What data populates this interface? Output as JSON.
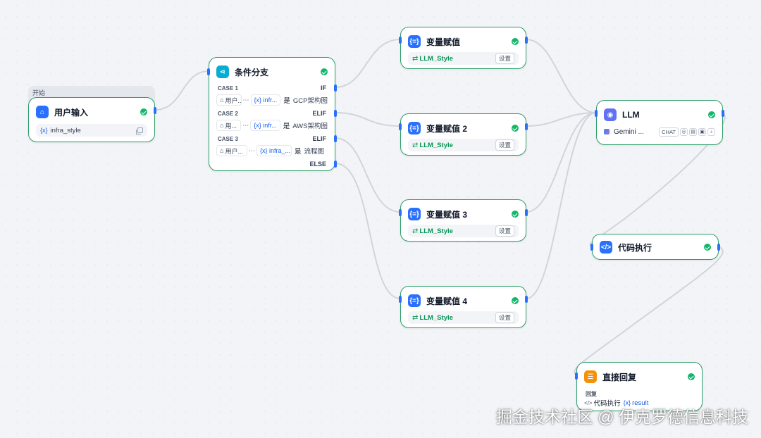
{
  "canvas": {
    "start_label": "开始",
    "watermark": "掘金技术社区 @ 伊克罗德信息科技"
  },
  "nodes": {
    "user_input": {
      "title": "用户输入",
      "icon": "home-icon",
      "variable": "infra_style"
    },
    "condition": {
      "title": "条件分支",
      "icon": "branch-icon",
      "cases": [
        {
          "label": "CASE 1",
          "keyword": "IF",
          "source": "用户...",
          "var": "infr...",
          "op": "是",
          "value": "GCP架构图"
        },
        {
          "label": "CASE 2",
          "keyword": "ELIF",
          "source": "用...",
          "var": "infr...",
          "op": "是",
          "value": "AWS架构图"
        },
        {
          "label": "CASE 3",
          "keyword": "ELIF",
          "source": "用户...",
          "var": "infra_...",
          "op": "是",
          "value": "流程图"
        }
      ],
      "else_label": "ELSE"
    },
    "assigners": [
      {
        "title": "变量赋值",
        "var": "LLM_Style",
        "button": "设置"
      },
      {
        "title": "变量赋值 2",
        "var": "LLM_Style",
        "button": "设置"
      },
      {
        "title": "变量赋值 3",
        "var": "LLM_Style",
        "button": "设置"
      },
      {
        "title": "变量赋值 4",
        "var": "LLM_Style",
        "button": "设置"
      }
    ],
    "llm": {
      "title": "LLM",
      "model": "Gemini ...",
      "mode_tag": "CHAT"
    },
    "code": {
      "title": "代码执行"
    },
    "answer": {
      "title": "直接回复",
      "reply_label": "回复",
      "source_node": "代码执行",
      "source_var": "result"
    }
  },
  "colors": {
    "node_border": "#2e9e6b",
    "edge": "#d0d5dd",
    "handle": "#2970ff",
    "success": "#12b76a",
    "variable": "#155eef",
    "style_var": "#079455"
  }
}
